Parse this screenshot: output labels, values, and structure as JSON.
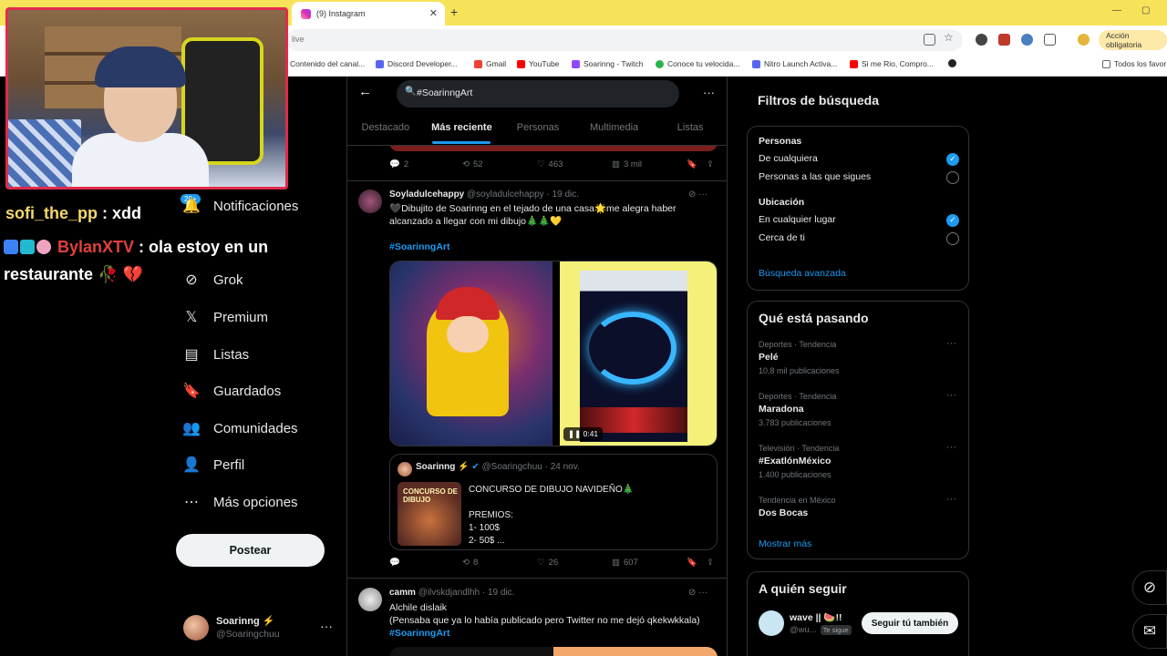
{
  "browser": {
    "tab_title": "(9) Instagram",
    "tab_close": "✕",
    "new_tab": "+",
    "url_text": "live",
    "action_button": "Acción obligatoria",
    "bookmarks": [
      {
        "label": "Contenido del canal...",
        "color": "#ff0000"
      },
      {
        "label": "Discord Developer...",
        "color": "#5865f2"
      },
      {
        "label": "Gmail",
        "color": "#ea4335"
      },
      {
        "label": "YouTube",
        "color": "#ff0000"
      },
      {
        "label": "Soarinng - Twitch",
        "color": "#9146ff"
      },
      {
        "label": "Conoce tu velocida...",
        "color": "#2bb24c"
      },
      {
        "label": "Nitro Launch Activa...",
        "color": "#5865f2"
      },
      {
        "label": "Si me Rio, Compro...",
        "color": "#ff0000"
      }
    ],
    "all_bookmarks": "Todos los favor"
  },
  "overlay": {
    "chat1_user": "sofi_the_pp",
    "chat1_msg": " : xdd",
    "chat2_user": "BylanXTV",
    "chat2_msg": " : ola estoy en un restaurante 🥀 💔"
  },
  "nav": {
    "badge": "20+",
    "items": [
      {
        "label": "Notificaciones",
        "icon": "🔔"
      },
      {
        "label": "Grok",
        "icon": "⊘"
      },
      {
        "label": "Premium",
        "icon": "𝕏"
      },
      {
        "label": "Listas",
        "icon": "▤"
      },
      {
        "label": "Guardados",
        "icon": "🔖"
      },
      {
        "label": "Comunidades",
        "icon": "👥"
      },
      {
        "label": "Perfil",
        "icon": "👤"
      },
      {
        "label": "Más opciones",
        "icon": "⋯"
      }
    ],
    "post_button": "Postear",
    "account_name": "Soarinng ⚡",
    "account_handle": "@Soaringchuu",
    "account_more": "···"
  },
  "search": {
    "query": "#SoarinngArt",
    "tabs": [
      "Destacado",
      "Más reciente",
      "Personas",
      "Multimedia",
      "Listas"
    ],
    "active_tab": 1
  },
  "tweet0": {
    "replies": "2",
    "retweets": "52",
    "likes": "463",
    "views": "3 mil"
  },
  "tweet1": {
    "name": "Soyladulcehappy",
    "handle": "@soyladulcehappy · 19 dic.",
    "text": "🖤Dibujito de Soarinng en el tejado de una casa🌟me alegra haber alcanzado a llegar con mi dibujo🎄🎄💛",
    "hashtag": "#SoarinngArt",
    "video_time": "0:41",
    "quote_name": "Soarinng ⚡",
    "quote_handle": "@Soaringchuu · 24 nov.",
    "quote_image_text": "CONCURSO DE DIBUJO",
    "quote_text_1": "CONCURSO DE DIBUJO NAVIDEÑO🎄",
    "quote_text_2": "PREMIOS:",
    "quote_text_3": " 1- 100$",
    "quote_text_4": "2- 50$ ...",
    "replies": "",
    "retweets": "8",
    "likes": "26",
    "views": "607"
  },
  "tweet2": {
    "name": "camm",
    "handle": "@ilvskdjandlhh · 19 dic.",
    "text_1": "Alchile dislaik",
    "text_2": "(Pensaba que ya lo había publicado pero Twitter no me dejó qkekwkkala)",
    "hashtag": "#SoarinngArt"
  },
  "filters": {
    "title": "Filtros de búsqueda",
    "people_label": "Personas",
    "people_opt1": "De cualquiera",
    "people_opt2": "Personas a las que sigues",
    "location_label": "Ubicación",
    "location_opt1": "En cualquier lugar",
    "location_opt2": "Cerca de ti",
    "advanced": "Búsqueda avanzada"
  },
  "trends": {
    "title": "Qué está pasando",
    "items": [
      {
        "meta": "Deportes · Tendencia",
        "name": "Pelé",
        "count": "10,8 mil publicaciones"
      },
      {
        "meta": "Deportes · Tendencia",
        "name": "Maradona",
        "count": "3.783 publicaciones"
      },
      {
        "meta": "Televisión · Tendencia",
        "name": "#ExatlónMéxico",
        "count": "1.400 publicaciones"
      },
      {
        "meta": "Tendencia en México",
        "name": "Dos Bocas",
        "count": ""
      }
    ],
    "more": "Mostrar más"
  },
  "follow": {
    "title": "A quién seguir",
    "name": "wave || 🍉!!",
    "handle": "@wu...",
    "tag": "Te sigue",
    "button": "Seguir tú también"
  },
  "colors": {
    "accent": "#1d9bf0",
    "border": "#2f3336",
    "stream_frame": "#e02b4b"
  }
}
